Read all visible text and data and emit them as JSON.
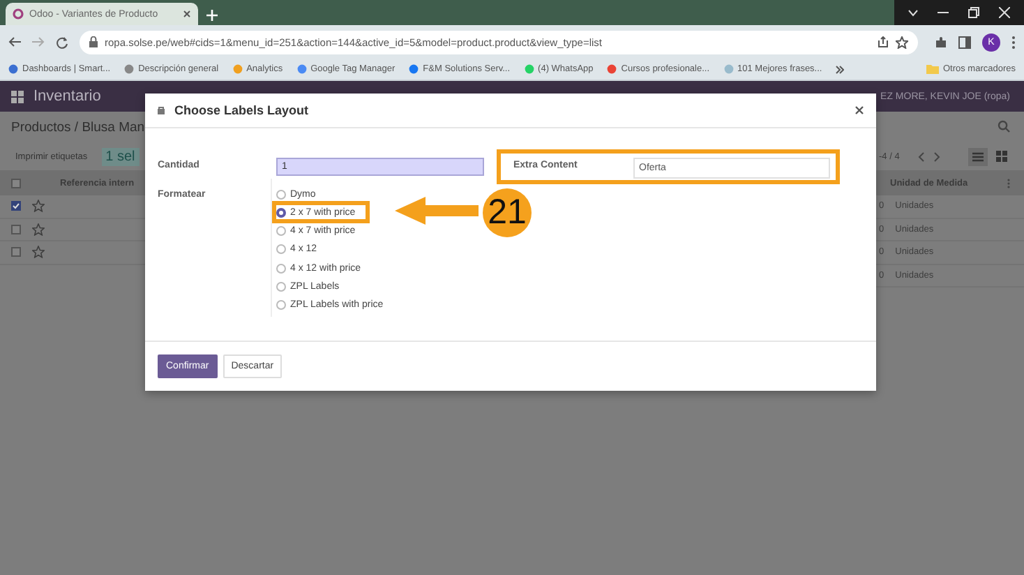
{
  "browser": {
    "tab_title": "Odoo - Variantes de Producto",
    "url": "ropa.solse.pe/web#cids=1&menu_id=251&action=144&active_id=5&model=product.product&view_type=list",
    "avatar": "K",
    "bookmarks": [
      {
        "label": "Dashboards | Smart..."
      },
      {
        "label": "Descripción general"
      },
      {
        "label": "Analytics"
      },
      {
        "label": "Google Tag Manager"
      },
      {
        "label": "F&M Solutions Serv..."
      },
      {
        "label": "(4) WhatsApp"
      },
      {
        "label": "Cursos profesionale..."
      },
      {
        "label": "101 Mejores frases..."
      }
    ],
    "other_bookmarks": "Otros marcadores"
  },
  "app": {
    "name": "Inventario",
    "user": "EZ MORE, KEVIN JOE (ropa)",
    "breadcrumb": "Productos / Blusa Man",
    "print_button": "Imprimir etiquetas",
    "selection": "1 sel",
    "pager": "-4 / 4",
    "columns": [
      "Referencia intern",
      "Unidad de Medida"
    ],
    "all_selected": false,
    "rows": [
      {
        "checked": true,
        "column_3": "0",
        "uom": "Unidades"
      },
      {
        "checked": false,
        "column_3": "0",
        "uom": "Unidades"
      },
      {
        "checked": false,
        "column_3": "0",
        "uom": "Unidades"
      },
      {
        "column_3": "0",
        "uom": "Unidades"
      }
    ]
  },
  "dialog": {
    "title": "Choose Labels Layout",
    "quantity_label": "Cantidad",
    "quantity": "1",
    "format_label": "Formatear",
    "extra_label": "Extra Content",
    "extra_value": "Oferta",
    "formats": [
      {
        "label": "Dymo",
        "selected": false
      },
      {
        "label": "2 x 7 with price",
        "selected": true
      },
      {
        "label": "4 x 7 with price",
        "selected": false
      },
      {
        "label": "4 x 12",
        "selected": false
      },
      {
        "label": "4 x 12 with price",
        "selected": false
      },
      {
        "label": "ZPL Labels",
        "selected": false
      },
      {
        "label": "ZPL Labels with price",
        "selected": false
      }
    ],
    "buttons": [
      {
        "label": "Confirmar",
        "kind": "primary"
      },
      {
        "label": "Descartar",
        "kind": "secondary"
      }
    ]
  },
  "annotation": {
    "step": "21"
  }
}
